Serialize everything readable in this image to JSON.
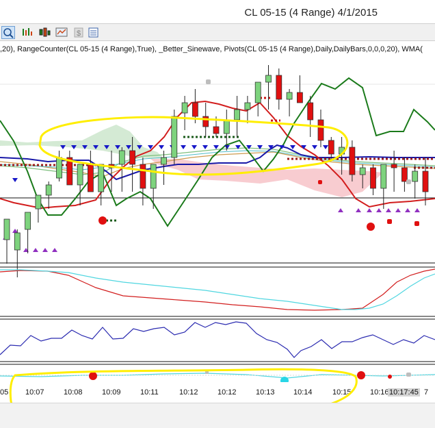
{
  "window": {
    "title": "CL 05-15 (4 Range)  4/1/2015"
  },
  "toolbar": {
    "buttons": [
      "zoom-icon",
      "chart-style-icon",
      "candlestick-icon",
      "data-box-icon",
      "dollar-icon",
      "properties-icon"
    ]
  },
  "indicators_text": ",20), RangeCounter(CL 05-15 (4 Range),True), _Better_Sinewave, Pivots(CL 05-15 (4 Range),Daily,DailyBars,0,0,0,20), WMA(",
  "time_axis": {
    "labels": [
      "05",
      "10:07",
      "10:08",
      "10:09",
      "10:11",
      "10:12",
      "10:12",
      "10:13",
      "10:14",
      "10:15",
      "10:16",
      "10:17:45",
      "7"
    ],
    "highlight": "10:17:45"
  },
  "colors": {
    "up_candle": "#7ed37e",
    "down_candle": "#e01010",
    "sinewave": "#1a7a1a",
    "leadsine": "#d21d1d",
    "pivot_line": "#2a2ab0",
    "annotation": "#ffee00",
    "cloud_green": "#cfe8cf",
    "cloud_pink": "#f7c3c8"
  },
  "chart_data": {
    "type": "candlestick",
    "candles": [
      {
        "o": 18,
        "h": 12,
        "l": 25,
        "c": 12
      },
      {
        "o": 21,
        "h": 15,
        "l": 29,
        "c": 16
      },
      {
        "o": 15,
        "h": 10,
        "l": 22,
        "c": 10
      },
      {
        "o": 9,
        "h": 5,
        "l": 13,
        "c": 5
      },
      {
        "o": 5,
        "h": 1,
        "l": 9,
        "c": 2
      },
      {
        "o": 0,
        "h": -8,
        "l": 1,
        "c": -6
      },
      {
        "o": -6,
        "h": -8,
        "l": 2,
        "c": 2
      },
      {
        "o": 2,
        "h": -4,
        "l": 8,
        "c": -4
      },
      {
        "o": -4,
        "h": -8,
        "l": 4,
        "c": 4
      },
      {
        "o": 4,
        "h": -4,
        "l": 8,
        "c": -4
      },
      {
        "o": -4,
        "h": -8,
        "l": 4,
        "c": -3
      },
      {
        "o": -4,
        "h": -9,
        "l": 4,
        "c": -8
      },
      {
        "o": -8,
        "h": -12,
        "l": 4,
        "c": -4
      },
      {
        "o": -4,
        "h": -6,
        "l": 8,
        "c": 3
      },
      {
        "o": 3,
        "h": -4,
        "l": 9,
        "c": -4
      },
      {
        "o": -4,
        "h": -8,
        "l": 2,
        "c": -6
      },
      {
        "o": -6,
        "h": -20,
        "l": -4,
        "c": -18
      },
      {
        "o": -19,
        "h": -24,
        "l": -14,
        "c": -22
      },
      {
        "o": -22,
        "h": -26,
        "l": -16,
        "c": -18
      },
      {
        "o": -18,
        "h": -22,
        "l": -12,
        "c": -15
      },
      {
        "o": -15,
        "h": -18,
        "l": -12,
        "c": -13
      },
      {
        "o": -13,
        "h": -20,
        "l": -8,
        "c": -17
      },
      {
        "o": -17,
        "h": -24,
        "l": -12,
        "c": -20
      },
      {
        "o": -20,
        "h": -24,
        "l": -16,
        "c": -22
      },
      {
        "o": -22,
        "h": -28,
        "l": -18,
        "c": -28
      },
      {
        "o": -28,
        "h": -33,
        "l": -20,
        "c": -30
      },
      {
        "o": -30,
        "h": -32,
        "l": -20,
        "c": -23
      },
      {
        "o": -23,
        "h": -26,
        "l": -18,
        "c": -25
      },
      {
        "o": -25,
        "h": -30,
        "l": -22,
        "c": -22
      },
      {
        "o": -22,
        "h": -24,
        "l": -12,
        "c": -17
      },
      {
        "o": -17,
        "h": -20,
        "l": -9,
        "c": -11
      },
      {
        "o": -11,
        "h": -12,
        "l": -5,
        "c": -7
      },
      {
        "o": -7,
        "h": -12,
        "l": -1,
        "c": -9
      },
      {
        "o": -9,
        "h": -11,
        "l": 1,
        "c": -1
      },
      {
        "o": -1,
        "h": -4,
        "l": 3,
        "c": -3
      },
      {
        "o": -3,
        "h": -4,
        "l": 5,
        "c": 3
      },
      {
        "o": 3,
        "h": -4,
        "l": 9,
        "c": -4
      },
      {
        "o": -4,
        "h": -8,
        "l": 4,
        "c": -3
      },
      {
        "o": -3,
        "h": -6,
        "l": 4,
        "c": 1
      },
      {
        "o": 1,
        "h": -4,
        "l": 6,
        "c": -2
      },
      {
        "o": -2,
        "h": -6,
        "l": 8,
        "c": 4
      }
    ]
  }
}
